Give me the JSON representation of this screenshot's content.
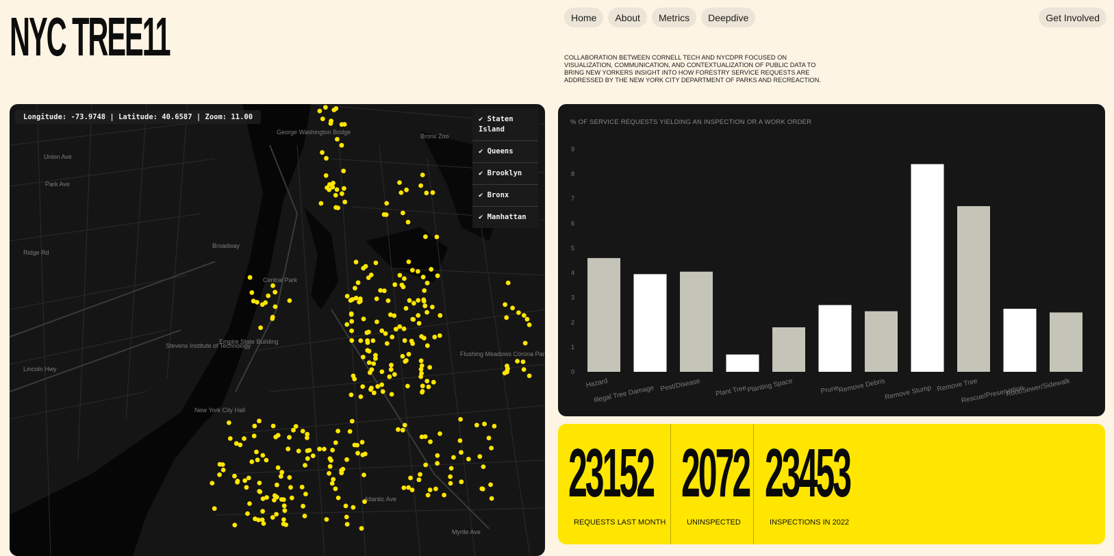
{
  "logo": "NYC TREE11",
  "nav": {
    "home": "Home",
    "about": "About",
    "metrics": "Metrics",
    "deepdive": "Deepdive",
    "get_involved": "Get Involved"
  },
  "description": "Collaboration between Cornell Tech and NYCDPR focused on visualization, communication, and contextualization of public data to bring New Yorkers insight into how forestry service requests are addressed by the New York City Department of Parks and Recreaction.",
  "map": {
    "coords": "Longitude: -73.9748 | Latitude: 40.6587 | Zoom: 11.00",
    "layers": [
      {
        "label": "✔ Staten Island"
      },
      {
        "label": "✔ Queens"
      },
      {
        "label": "✔ Brooklyn"
      },
      {
        "label": "✔ Bronx"
      },
      {
        "label": "✔ Manhattan"
      }
    ],
    "place_labels": [
      "George Washington Bridge",
      "Bronx Zoo",
      "Central Park",
      "Empire State Building",
      "Stevens Institute of Technology",
      "New York City Hall",
      "Flushing Meadows Corona Park",
      "Union Ave",
      "Park Ave",
      "Ridge Rd",
      "Lincoln Hwy",
      "Atlantic Ave",
      "Myrtle Ave",
      "Broadway"
    ],
    "point_color": "#ffe600"
  },
  "chart_data": {
    "type": "bar",
    "title": "% of service requests yielding an inspection or a work order",
    "categories": [
      "Hazard",
      "Illegal Tree Damage",
      "Pest/Disease",
      "Plant Tree",
      "Planting Space",
      "Prune",
      "Remove Debris",
      "Remove Stump",
      "Remove Tree",
      "Rescue/Preservation",
      "Root/Sewer/Sidewalk"
    ],
    "values": [
      4.6,
      3.95,
      4.05,
      0.7,
      1.8,
      2.7,
      2.45,
      8.4,
      6.7,
      2.55,
      2.4
    ],
    "bar_colors": [
      "#c4c4b9",
      "#ffffff",
      "#c4c4b9",
      "#ffffff",
      "#c4c4b9",
      "#ffffff",
      "#c4c4b9",
      "#ffffff",
      "#c4c4b9",
      "#ffffff",
      "#c4c4b9"
    ],
    "ylim": [
      0,
      9
    ],
    "yticks": [
      "0",
      "1",
      "2",
      "3",
      "4",
      "5",
      "6",
      "7",
      "8",
      "9"
    ],
    "grid": false
  },
  "stats": [
    {
      "value": "23152",
      "label": "REQUESTS LAST MONTH"
    },
    {
      "value": "2072",
      "label": "UNINSPECTED"
    },
    {
      "value": "23453",
      "label": "INSPECTIONS IN 2022"
    }
  ]
}
